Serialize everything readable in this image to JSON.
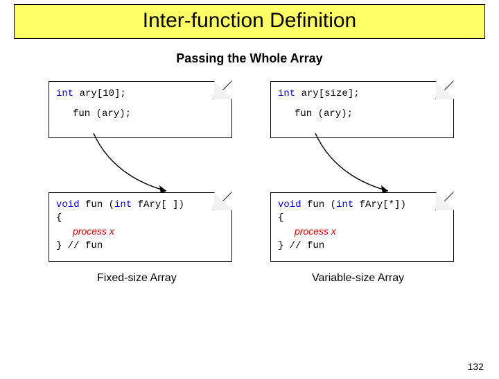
{
  "title": "Inter-function Definition",
  "subtitle": "Passing the Whole Array",
  "left": {
    "top": {
      "decl_kw": "int",
      "decl_rest": " ary[10];",
      "call": "fun (ary);"
    },
    "bottom": {
      "sig_kw": "void",
      "sig_mid": " fun (",
      "sig_int": "int",
      "sig_rest": " fAry[ ])",
      "brace_open": "{",
      "process": "process x",
      "brace_close": "}",
      "comment": "  // fun"
    },
    "caption": "Fixed-size Array"
  },
  "right": {
    "top": {
      "decl_kw": "int",
      "decl_rest": " ary[size];",
      "call": "fun (ary);"
    },
    "bottom": {
      "sig_kw": "void",
      "sig_mid": " fun (",
      "sig_int": "int",
      "sig_rest": " fAry[*])",
      "brace_open": "{",
      "process": "process x",
      "brace_close": "}",
      "comment": "  // fun"
    },
    "caption": "Variable-size Array"
  },
  "page_number": "132"
}
